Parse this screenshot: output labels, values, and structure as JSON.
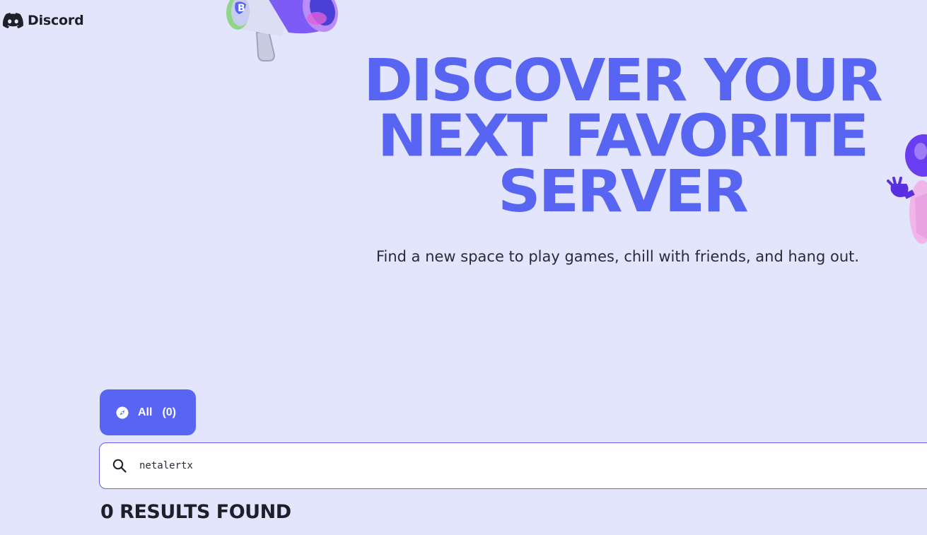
{
  "header": {
    "brand_name": "Discord",
    "logo_icon": "discord-logo-icon"
  },
  "hero": {
    "title_lines": [
      "DISCOVER YOUR",
      "NEXT FAVORITE",
      "SERVER"
    ],
    "subtitle": "Find a new space to play games, chill with friends, and hang out.",
    "title_color": "#5865f2"
  },
  "decorations": {
    "megaphone": "megaphone-illustration",
    "mascot": "mascot-illustration"
  },
  "categories": [
    {
      "label": "All",
      "count": "(0)",
      "icon": "compass-icon",
      "selected": true
    }
  ],
  "search": {
    "value": "netalertx",
    "icon": "search-icon"
  },
  "results": {
    "label": "0 RESULTS FOUND"
  },
  "colors": {
    "background": "#e3e5fd",
    "accent": "#5865f2",
    "text_dark": "#1f1f2a"
  }
}
